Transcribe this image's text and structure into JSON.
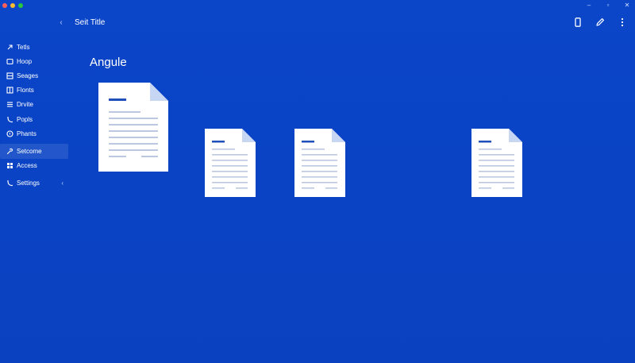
{
  "window": {
    "title": "Seit Title",
    "traffic_colors": [
      "#ff5f57",
      "#febc2e",
      "#28c840"
    ],
    "controls": [
      "minimize-icon",
      "maximize-icon",
      "close-icon"
    ]
  },
  "topbar": {
    "collapse_icon": "chevron-left-icon",
    "actions": [
      "phone-icon",
      "edit-icon",
      "more-vertical-icon"
    ]
  },
  "sidebar": {
    "items": [
      {
        "label": "Tetls",
        "icon": "arrow-icon"
      },
      {
        "label": "Hoop",
        "icon": "image-icon"
      },
      {
        "label": "Seages",
        "icon": "grid-icon"
      },
      {
        "label": "Flonts",
        "icon": "layout-icon"
      },
      {
        "label": "Drvite",
        "icon": "list-icon"
      },
      {
        "label": "Popls",
        "icon": "phone-icon"
      },
      {
        "label": "Phants",
        "icon": "help-circle-icon"
      },
      {
        "label": "Setcome",
        "icon": "tools-icon",
        "active": true
      },
      {
        "label": "Access",
        "icon": "apps-icon"
      },
      {
        "label": "Settings",
        "icon": "phone-icon",
        "chevron": "‹"
      }
    ]
  },
  "main": {
    "heading": "Angule",
    "documents": [
      "document-icon",
      "document-icon",
      "document-icon",
      "document-icon"
    ]
  },
  "colors": {
    "background": "#0a44c6",
    "paper": "#ffffff",
    "fold": "#c7d6f3",
    "title_line": "#1f4fb8",
    "text_line": "#bcc8df"
  }
}
